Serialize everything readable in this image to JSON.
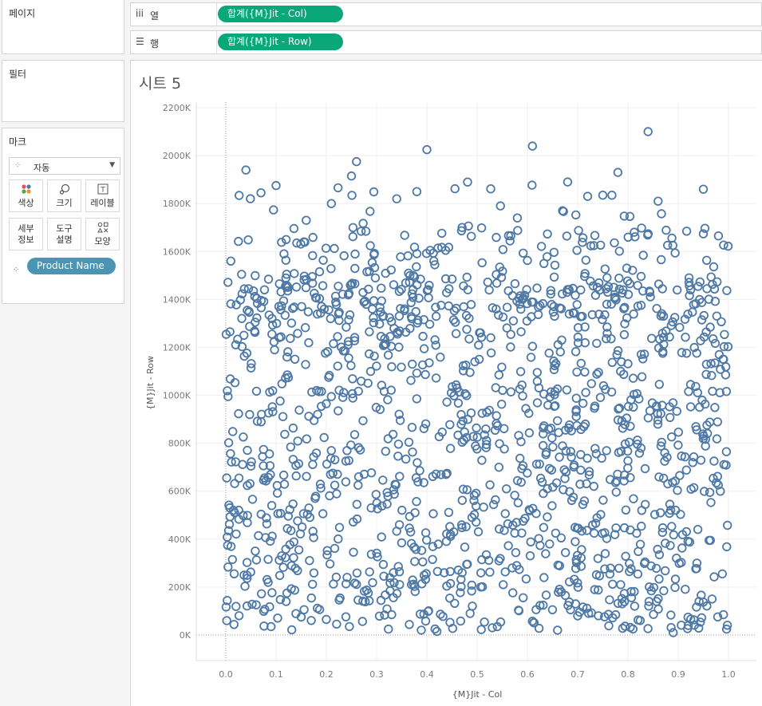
{
  "left_panel": {
    "pages_title": "페이지",
    "filters_title": "필터",
    "marks": {
      "title": "마크",
      "type_select": "자동",
      "buttons": {
        "color": "색상",
        "size": "크기",
        "label": "레이블",
        "detail_line1": "세부",
        "detail_line2": "정보",
        "tooltip_line1": "도구",
        "tooltip_line2": "설명",
        "shape": "모양"
      },
      "detail_pill": "Product Name"
    }
  },
  "shelves": {
    "columns": {
      "label": "열",
      "pill": "합계({M}Jit - Col)"
    },
    "rows": {
      "label": "행",
      "pill": "합계({M}Jit - Row)"
    }
  },
  "sheet": {
    "title": "시트 5"
  },
  "colors": {
    "mark": "#4e79a7",
    "pill_green": "#0aa878",
    "pill_teal": "#4b95b4"
  },
  "chart_data": {
    "type": "scatter",
    "title": "",
    "xlabel": "{M}Jit - Col",
    "ylabel": "{M}Jit - Row",
    "xlim": [
      0.0,
      1.0
    ],
    "ylim": [
      0,
      2200000
    ],
    "x_ticks": [
      "0.0",
      "0.1",
      "0.2",
      "0.3",
      "0.4",
      "0.5",
      "0.6",
      "0.7",
      "0.8",
      "0.9",
      "1.0"
    ],
    "y_ticks": [
      "0K",
      "200K",
      "400K",
      "600K",
      "800K",
      "1000K",
      "1200K",
      "1400K",
      "1600K",
      "1800K",
      "2000K",
      "2200K"
    ],
    "grid": true,
    "marker": "hollow-circle",
    "point_count": 1500,
    "points": [
      [
        0.04,
        1940000
      ],
      [
        0.07,
        1845000
      ],
      [
        0.1,
        1875000
      ],
      [
        0.26,
        1975000
      ],
      [
        0.25,
        1915000
      ],
      [
        0.4,
        2025000
      ],
      [
        0.61,
        2040000
      ],
      [
        0.84,
        2100000
      ],
      [
        0.78,
        1930000
      ],
      [
        0.68,
        1890000
      ],
      [
        0.95,
        1860000
      ],
      [
        0.86,
        1810000
      ],
      [
        0.75,
        1835000
      ],
      [
        0.38,
        1850000
      ],
      [
        0.21,
        1800000
      ],
      [
        0.34,
        1820000
      ],
      [
        0.01,
        1560000
      ],
      [
        0.98,
        1665000
      ],
      [
        0.09,
        35000
      ],
      [
        0.2,
        65000
      ],
      [
        0.15,
        75000
      ],
      [
        0.42,
        15000
      ],
      [
        0.54,
        35000
      ],
      [
        0.66,
        20000
      ],
      [
        0.81,
        25000
      ],
      [
        0.89,
        10000
      ],
      [
        0.92,
        40000
      ],
      [
        0.99,
        85000
      ],
      [
        0.33,
        85000
      ],
      [
        0.7,
        80000
      ],
      [
        0.16,
        1730000
      ],
      [
        0.58,
        1740000
      ],
      [
        0.67,
        1770000
      ],
      [
        0.47,
        1700000
      ],
      [
        0.12,
        1650000
      ]
    ]
  }
}
